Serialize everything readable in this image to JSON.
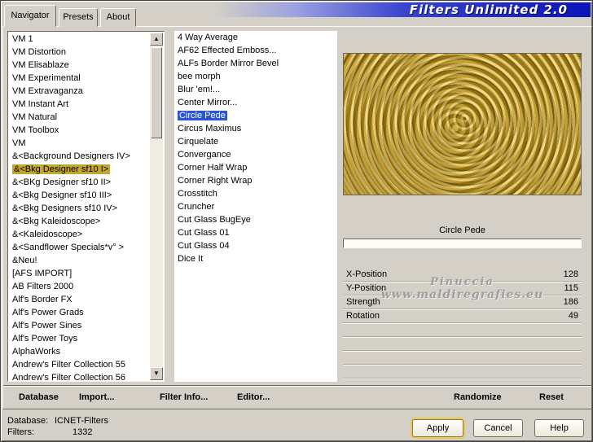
{
  "window": {
    "title": "Filters Unlimited 2.0"
  },
  "tabs": [
    {
      "label": "Navigator",
      "active": true
    },
    {
      "label": "Presets",
      "active": false
    },
    {
      "label": "About",
      "active": false
    }
  ],
  "category_list": {
    "selected_index": 10,
    "items": [
      "VM 1",
      "VM Distortion",
      "VM Elisablaze",
      "VM Experimental",
      "VM Extravaganza",
      "VM Instant Art",
      "VM Natural",
      "VM Toolbox",
      "VM",
      "&<Background Designers IV>",
      "&<Bkg Designer sf10 I>",
      "&<BKg Designer sf10 II>",
      "&<Bkg Designer sf10 III>",
      "&<Bkg Designers sf10 IV>",
      "&<Bkg Kaleidoscope>",
      "&<Kaleidoscope>",
      "&<Sandflower Specials*v° >",
      "&Neu!",
      "[AFS IMPORT]",
      "AB Filters 2000",
      "Alf's Border FX",
      "Alf's Power Grads",
      "Alf's Power Sines",
      "Alf's Power Toys",
      "AlphaWorks",
      "Andrew's Filter Collection 55",
      "Andrew's Filter Collection 56"
    ]
  },
  "filter_list": {
    "selected_index": 6,
    "items": [
      "4 Way Average",
      "AF62 Effected Emboss...",
      "ALFs Border Mirror Bevel",
      "bee morph",
      "Blur 'em!...",
      "Center Mirror...",
      "Circle Pede",
      "Circus Maximus",
      "Cirquelate",
      "Convergance",
      "Corner Half Wrap",
      "Corner Right Wrap",
      "Crosstitch",
      "Cruncher",
      "Cut Glass BugEye",
      "Cut Glass 01",
      "Cut Glass 04",
      "Dice It"
    ]
  },
  "preview": {
    "filter_name": "Circle Pede",
    "watermark_line1": "Pinuccia",
    "watermark_line2": "www.maldiregrafies.eu"
  },
  "parameters": [
    {
      "name": "X-Position",
      "value": "128"
    },
    {
      "name": "Y-Position",
      "value": "115"
    },
    {
      "name": "Strength",
      "value": "186"
    },
    {
      "name": "Rotation",
      "value": "49"
    }
  ],
  "toolbar": {
    "database": "Database",
    "import": "Import...",
    "filter_info": "Filter Info...",
    "editor": "Editor...",
    "randomize": "Randomize",
    "reset": "Reset"
  },
  "status": {
    "database_label": "Database:",
    "database_value": "ICNET-Filters",
    "filters_label": "Filters:",
    "filters_value": "1332"
  },
  "buttons": {
    "apply": "Apply",
    "cancel": "Cancel",
    "help": "Help"
  },
  "colors": {
    "selection_blue": "#2b55d4",
    "selection_gold": "#c2a82a",
    "titlebar_blue": "#0b14b8",
    "dialog_gray": "#d4d0c8"
  }
}
